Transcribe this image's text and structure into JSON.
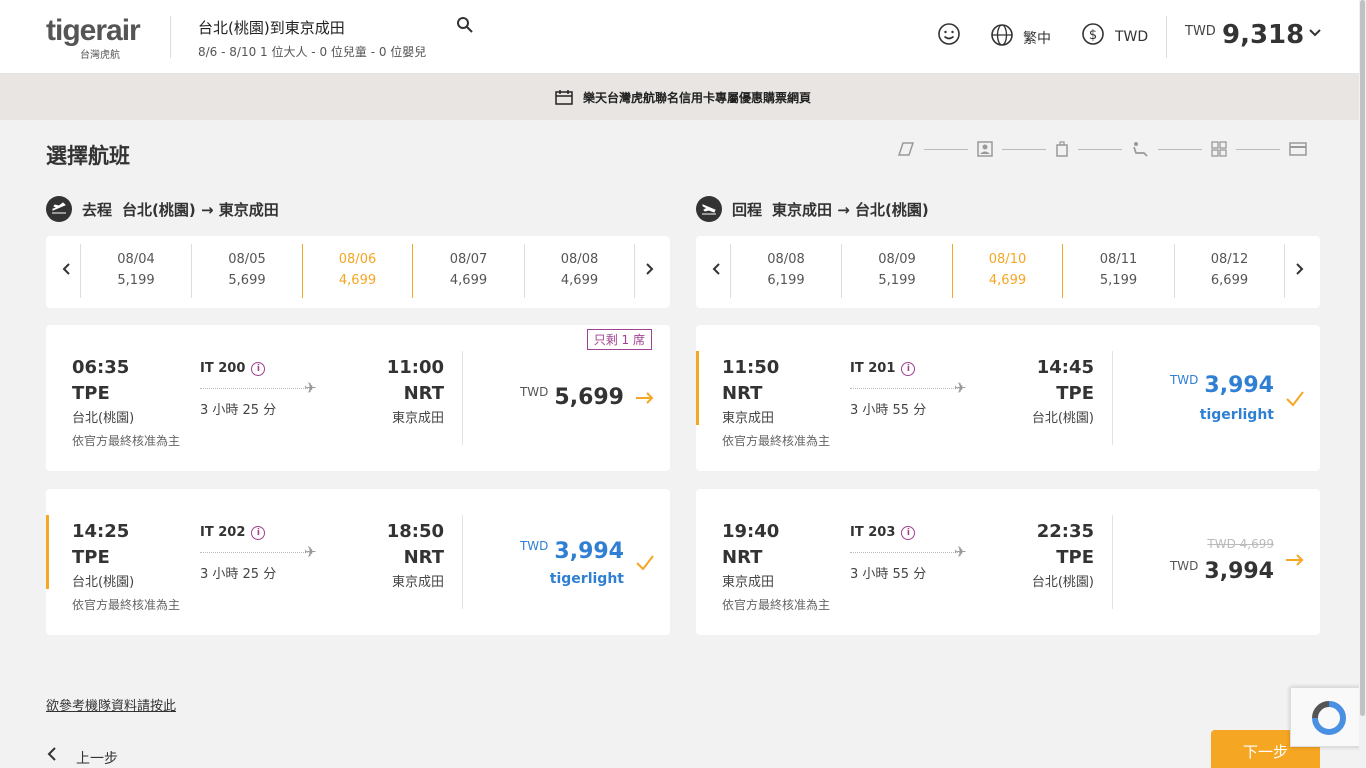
{
  "header": {
    "logo_text": "tigerair",
    "logo_subtitle": "台灣虎航",
    "route_title": "台北(桃園)到東京成田",
    "route_sub": "8/6 - 8/10  1 位大人 - 0 位兒童 - 0 位嬰兒",
    "language": "繁中",
    "currency": "TWD",
    "total_currency": "TWD",
    "total_amount": "9,318"
  },
  "promo": {
    "text": "樂天台灣虎航聯名信用卡專屬優惠購票網頁"
  },
  "page_title": "選擇航班",
  "outbound": {
    "label": "去程",
    "route": "台北(桃園) → 東京成田",
    "dates": [
      {
        "date": "08/04",
        "price": "5,199"
      },
      {
        "date": "08/05",
        "price": "5,699"
      },
      {
        "date": "08/06",
        "price": "4,699"
      },
      {
        "date": "08/07",
        "price": "4,699"
      },
      {
        "date": "08/08",
        "price": "4,699"
      }
    ],
    "flights": [
      {
        "dep_time": "06:35",
        "dep_code": "TPE",
        "dep_city": "台北(桃園)",
        "flight_no": "IT 200",
        "duration": "3 小時 25 分",
        "arr_time": "11:00",
        "arr_code": "NRT",
        "arr_city": "東京成田",
        "note": "依官方最終核准為主",
        "currency": "TWD",
        "price": "5,699",
        "seats_left": "只剩 1 席"
      },
      {
        "dep_time": "14:25",
        "dep_code": "TPE",
        "dep_city": "台北(桃園)",
        "flight_no": "IT 202",
        "duration": "3 小時 25 分",
        "arr_time": "18:50",
        "arr_code": "NRT",
        "arr_city": "東京成田",
        "note": "依官方最終核准為主",
        "currency": "TWD",
        "price": "3,994",
        "fare": "tigerlight"
      }
    ]
  },
  "inbound": {
    "label": "回程",
    "route": "東京成田 → 台北(桃園)",
    "dates": [
      {
        "date": "08/08",
        "price": "6,199"
      },
      {
        "date": "08/09",
        "price": "5,199"
      },
      {
        "date": "08/10",
        "price": "4,699"
      },
      {
        "date": "08/11",
        "price": "5,199"
      },
      {
        "date": "08/12",
        "price": "6,699"
      }
    ],
    "flights": [
      {
        "dep_time": "11:50",
        "dep_code": "NRT",
        "dep_city": "東京成田",
        "flight_no": "IT 201",
        "duration": "3 小時 55 分",
        "arr_time": "14:45",
        "arr_code": "TPE",
        "arr_city": "台北(桃園)",
        "note": "依官方最終核准為主",
        "currency": "TWD",
        "price": "3,994",
        "fare": "tigerlight"
      },
      {
        "dep_time": "19:40",
        "dep_code": "NRT",
        "dep_city": "東京成田",
        "flight_no": "IT 203",
        "duration": "3 小時 55 分",
        "arr_time": "22:35",
        "arr_code": "TPE",
        "arr_city": "台北(桃園)",
        "note": "依官方最終核准為主",
        "currency": "TWD",
        "price": "3,994",
        "old_price": "TWD 4,699"
      }
    ]
  },
  "footer": {
    "fleet_link": "欲參考機隊資料請按此",
    "back_label": "上一步",
    "next_label": "下一步"
  },
  "colors": {
    "accent": "#f5a623",
    "blue": "#2f7fd3",
    "purple": "#a0428f"
  }
}
